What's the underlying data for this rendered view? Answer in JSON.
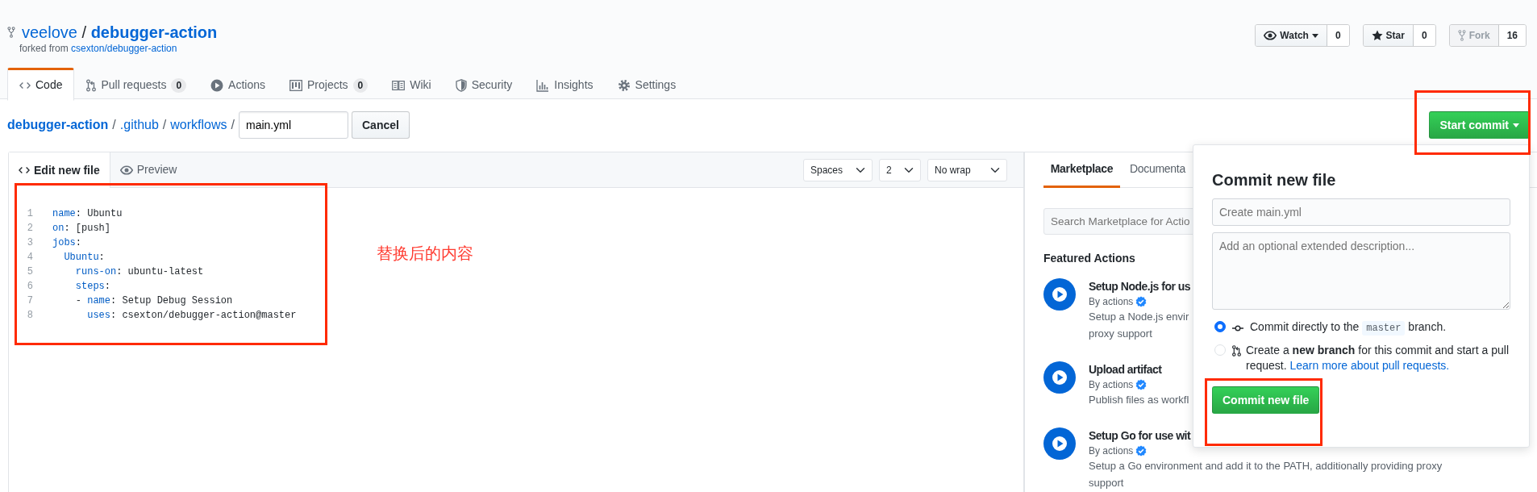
{
  "repo": {
    "owner": "veelove",
    "separator": "/",
    "name": "debugger-action",
    "forked_label": "forked from",
    "forked_from": "csexton/debugger-action"
  },
  "repo_actions": [
    {
      "kind": "watch",
      "label": "Watch",
      "count": "0",
      "disabled": false
    },
    {
      "kind": "star",
      "label": "Star",
      "count": "0",
      "disabled": false
    },
    {
      "kind": "fork",
      "label": "Fork",
      "count": "16",
      "disabled": true
    }
  ],
  "tabs": [
    {
      "kind": "code",
      "label": "Code",
      "selected": true
    },
    {
      "kind": "pull-request",
      "label": "Pull requests",
      "counter": "0",
      "selected": false
    },
    {
      "kind": "actions",
      "label": "Actions",
      "selected": false
    },
    {
      "kind": "projects",
      "label": "Projects",
      "counter": "0",
      "selected": false
    },
    {
      "kind": "wiki",
      "label": "Wiki",
      "selected": false
    },
    {
      "kind": "security",
      "label": "Security",
      "selected": false
    },
    {
      "kind": "insights",
      "label": "Insights",
      "selected": false
    },
    {
      "kind": "settings",
      "label": "Settings",
      "selected": false
    }
  ],
  "breadcrumb": [
    {
      "kind": "root",
      "text": "debugger-action"
    },
    {
      "kind": "separator",
      "text": "/"
    },
    {
      "kind": "folder",
      "text": ".github"
    },
    {
      "kind": "separator",
      "text": "/"
    },
    {
      "kind": "folder",
      "text": "workflows"
    },
    {
      "kind": "separator",
      "text": "/"
    }
  ],
  "file_name": {
    "value": "main.yml"
  },
  "cancel_button": "Cancel",
  "start_commit_button": "Start commit",
  "editor": {
    "tabs": [
      {
        "kind": "edit",
        "label": "Edit new file",
        "selected": true
      },
      {
        "kind": "preview",
        "label": "Preview",
        "selected": false
      }
    ],
    "selects": [
      {
        "value": "Spaces"
      },
      {
        "value": "2"
      },
      {
        "value": "No wrap"
      }
    ],
    "lines": [
      {
        "number": "1",
        "tokens": [
          {
            "kind": "key",
            "text": "name"
          },
          {
            "kind": "plain",
            "text": ": Ubuntu"
          }
        ]
      },
      {
        "number": "2",
        "tokens": [
          {
            "kind": "key",
            "text": "on"
          },
          {
            "kind": "plain",
            "text": ": [push]"
          }
        ]
      },
      {
        "number": "3",
        "tokens": [
          {
            "kind": "key",
            "text": "jobs"
          },
          {
            "kind": "plain",
            "text": ":"
          }
        ]
      },
      {
        "number": "4",
        "tokens": [
          {
            "kind": "key",
            "text": "  Ubuntu"
          },
          {
            "kind": "plain",
            "text": ":"
          }
        ]
      },
      {
        "number": "5",
        "tokens": [
          {
            "kind": "key",
            "text": "    runs-on"
          },
          {
            "kind": "plain",
            "text": ": ubuntu-latest"
          }
        ]
      },
      {
        "number": "6",
        "tokens": [
          {
            "kind": "key",
            "text": "    steps"
          },
          {
            "kind": "plain",
            "text": ":"
          }
        ]
      },
      {
        "number": "7",
        "tokens": [
          {
            "kind": "plain",
            "text": "    - "
          },
          {
            "kind": "key",
            "text": "name"
          },
          {
            "kind": "plain",
            "text": ": Setup Debug Session"
          }
        ]
      },
      {
        "number": "8",
        "tokens": [
          {
            "kind": "key",
            "text": "      uses"
          },
          {
            "kind": "plain",
            "text": ": csexton/debugger-action@master"
          }
        ]
      }
    ]
  },
  "annotation": "替换后的内容",
  "marketplace": {
    "tabs": [
      {
        "label": "Marketplace",
        "selected": true
      },
      {
        "label": "Documenta",
        "selected": false
      }
    ],
    "search": {
      "placeholder": "Search Marketplace for Actio"
    },
    "heading": "Featured Actions",
    "actions": [
      {
        "title": "Setup Node.js for us",
        "author": "By actions",
        "description": [
          "Setup a Node.js envir",
          "proxy support"
        ]
      },
      {
        "title": "Upload artifact",
        "author": "By actions",
        "description": [
          "Publish files as workfl"
        ]
      },
      {
        "title": "Setup Go for use wit",
        "author": "By actions",
        "description": [
          "Setup a Go environment and add it to the PATH, additionally providing proxy",
          "support"
        ]
      }
    ]
  },
  "commit_dialog": {
    "title": "Commit new file",
    "summary": {
      "placeholder": "Create main.yml"
    },
    "description": {
      "placeholder": "Add an optional extended description..."
    },
    "options": [
      {
        "kind": "direct",
        "selected": true,
        "text": "Commit directly to the",
        "branch": "master",
        "after": "branch."
      },
      {
        "kind": "new-branch",
        "selected": false,
        "text": "Create a **new branch** for this commit and start a pull request.",
        "link": "Learn more about pull requests."
      }
    ],
    "button": "Commit new file"
  }
}
